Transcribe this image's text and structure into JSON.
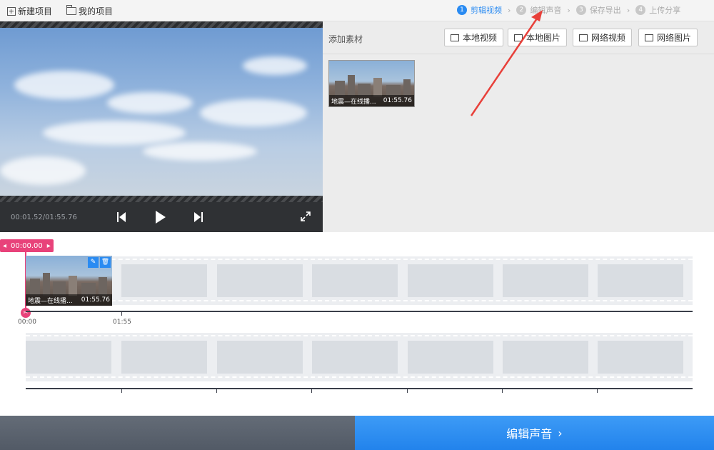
{
  "toolbar": {
    "new_project": "新建项目",
    "my_projects": "我的项目"
  },
  "steps": [
    {
      "num": "1",
      "label": "剪辑视频"
    },
    {
      "num": "2",
      "label": "编辑声音"
    },
    {
      "num": "3",
      "label": "保存导出"
    },
    {
      "num": "4",
      "label": "上传分享"
    }
  ],
  "player": {
    "time": "00:01.52/01:55.76"
  },
  "assets": {
    "title": "添加素材",
    "buttons": [
      "本地视频",
      "本地图片",
      "网络视频",
      "网络图片"
    ],
    "thumb_name": "地震—在线播...",
    "thumb_duration": "01:55.76"
  },
  "timeline": {
    "marker": "00:00.00",
    "clip_name": "地震—在线播...",
    "clip_duration": "01:55.76",
    "ticks": [
      "00:00",
      "01:55"
    ]
  },
  "footer": {
    "next_label": "编辑声音"
  },
  "colors": {
    "accent": "#2a8bf2",
    "marker": "#e8427a",
    "arrow": "#e8403a"
  }
}
